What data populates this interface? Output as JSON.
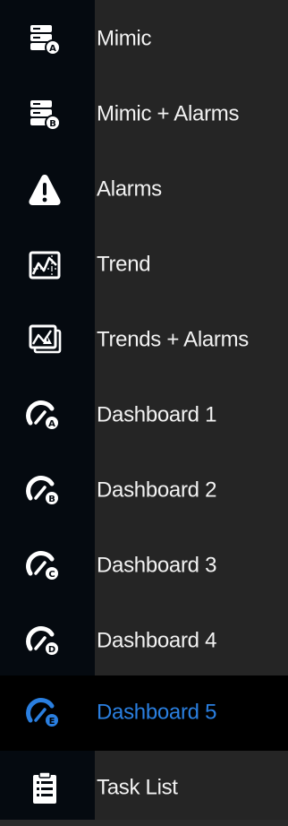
{
  "menu": {
    "active_color": "#2a7fe0",
    "text_color": "#f2f2f2",
    "items": [
      {
        "label": "Mimic",
        "icon": "mimic-a-icon",
        "active": false
      },
      {
        "label": "Mimic + Alarms",
        "icon": "mimic-b-icon",
        "active": false
      },
      {
        "label": "Alarms",
        "icon": "alarm-warning-icon",
        "active": false
      },
      {
        "label": "Trend",
        "icon": "trend-icon",
        "active": false
      },
      {
        "label": "Trends + Alarms",
        "icon": "trends-alarms-icon",
        "active": false
      },
      {
        "label": "Dashboard 1",
        "icon": "dashboard-gauge-a-icon",
        "active": false
      },
      {
        "label": "Dashboard 2",
        "icon": "dashboard-gauge-b-icon",
        "active": false
      },
      {
        "label": "Dashboard 3",
        "icon": "dashboard-gauge-c-icon",
        "active": false
      },
      {
        "label": "Dashboard 4",
        "icon": "dashboard-gauge-d-icon",
        "active": false
      },
      {
        "label": "Dashboard 5",
        "icon": "dashboard-gauge-e-icon",
        "active": true
      },
      {
        "label": "Task List",
        "icon": "task-list-icon",
        "active": false
      }
    ]
  }
}
